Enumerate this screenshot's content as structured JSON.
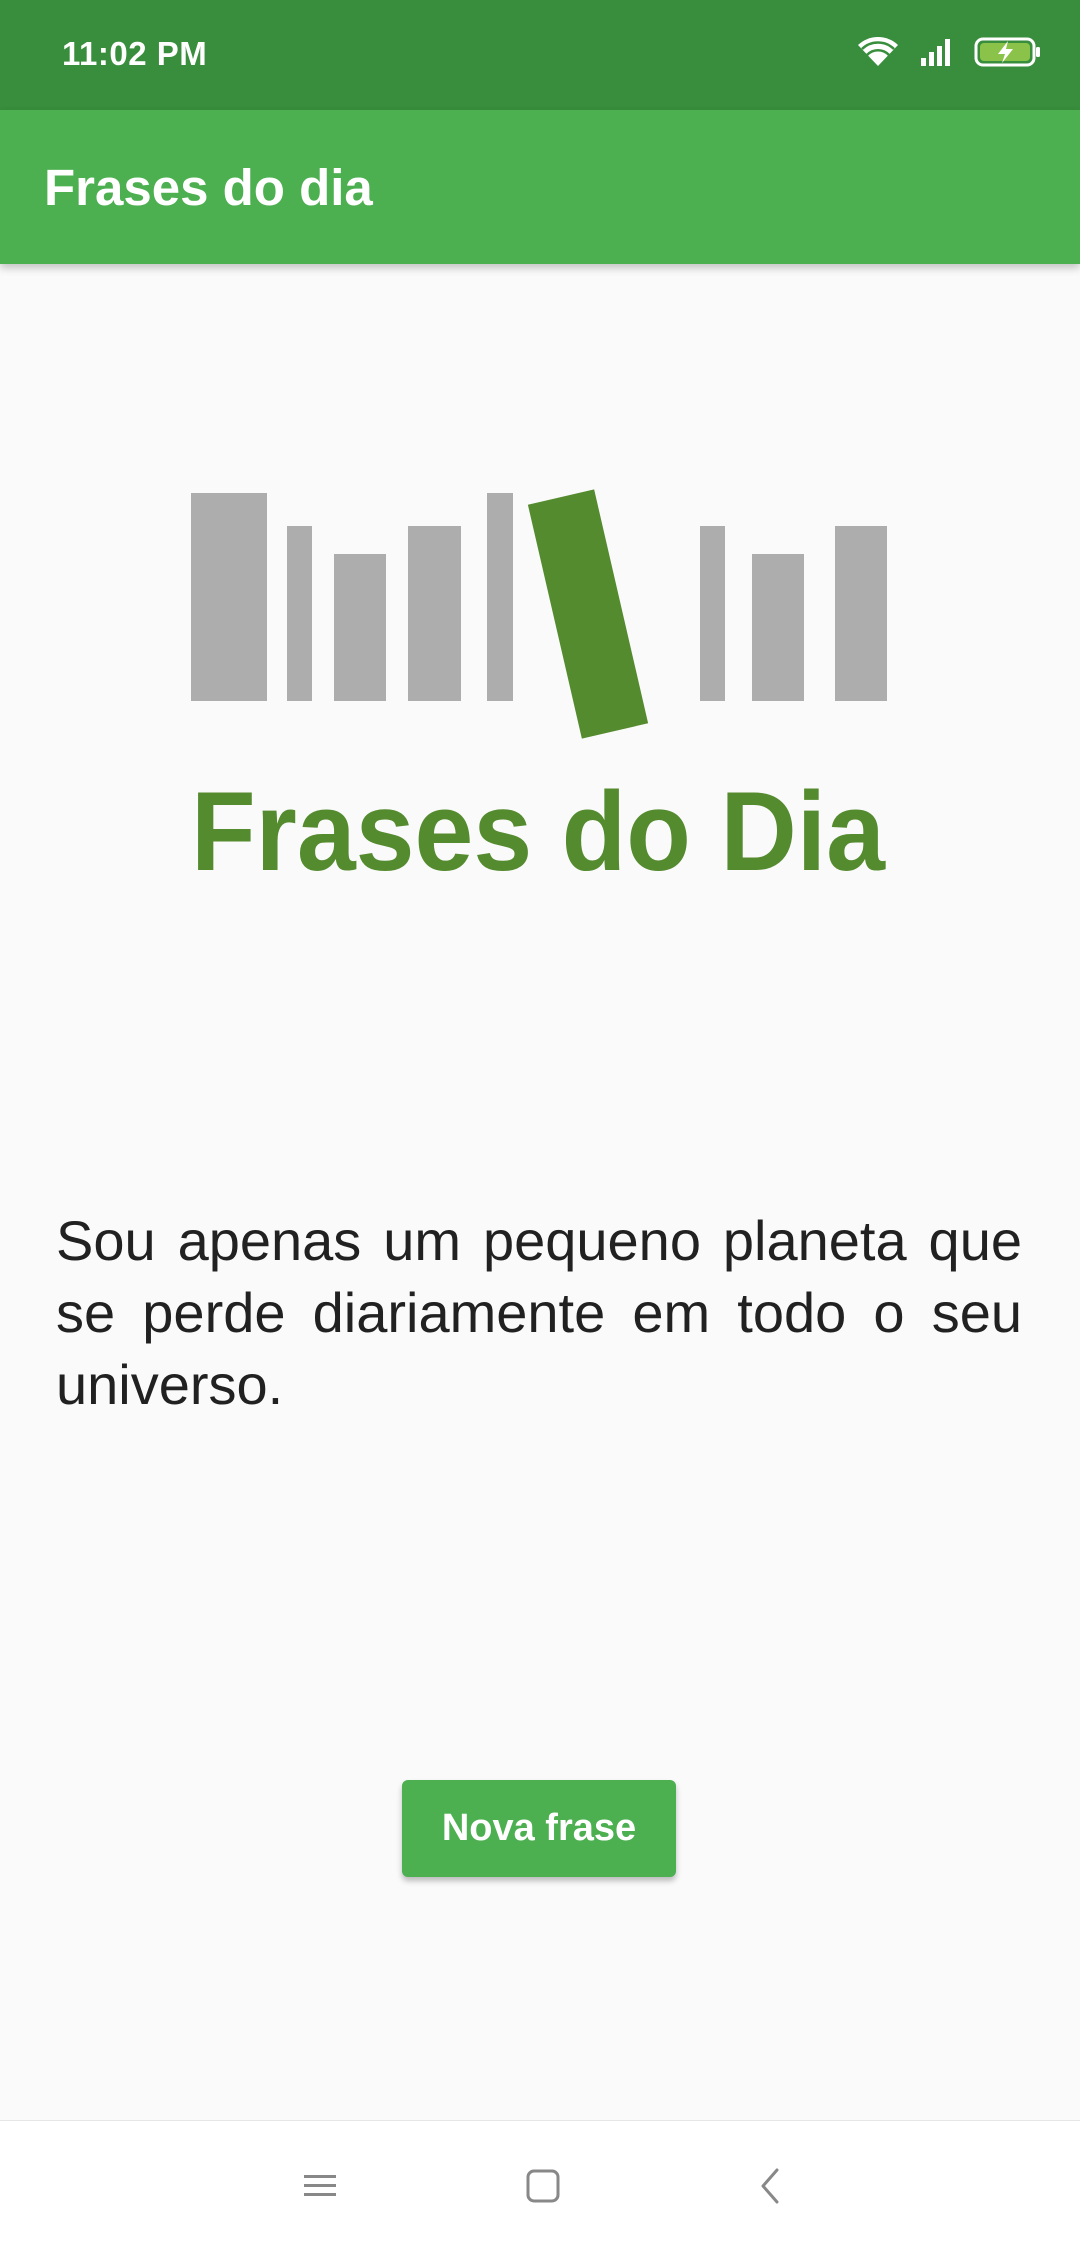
{
  "status_bar": {
    "time": "11:02 PM",
    "icons": [
      "wifi-icon",
      "signal-icon",
      "battery-charging-icon"
    ],
    "color": "#388e3c"
  },
  "app_bar": {
    "title": "Frases do dia",
    "color": "#4caf50"
  },
  "logo": {
    "text": "Frases do Dia",
    "text_color": "#558b2f",
    "book_color": "#adadad"
  },
  "quote": {
    "text": "Sou apenas um pequeno planeta que se perde diariamente em todo o seu universo."
  },
  "actions": {
    "new_phrase_label": "Nova frase"
  },
  "nav_bar": {
    "icons": [
      "menu-icon",
      "home-icon",
      "back-icon"
    ]
  }
}
